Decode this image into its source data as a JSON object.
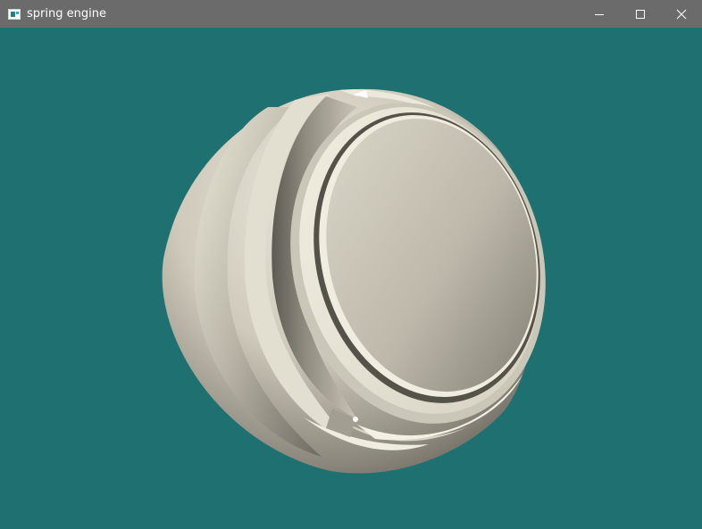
{
  "window": {
    "title": "spring engine",
    "icon": "app-window-icon",
    "controls": [
      "minimize-icon",
      "maximize-icon",
      "close-icon"
    ]
  },
  "viewport": {
    "background_color": "#1f7070",
    "object_color": "#d9d5c5",
    "object": "3d-rendered-capsule-model"
  }
}
